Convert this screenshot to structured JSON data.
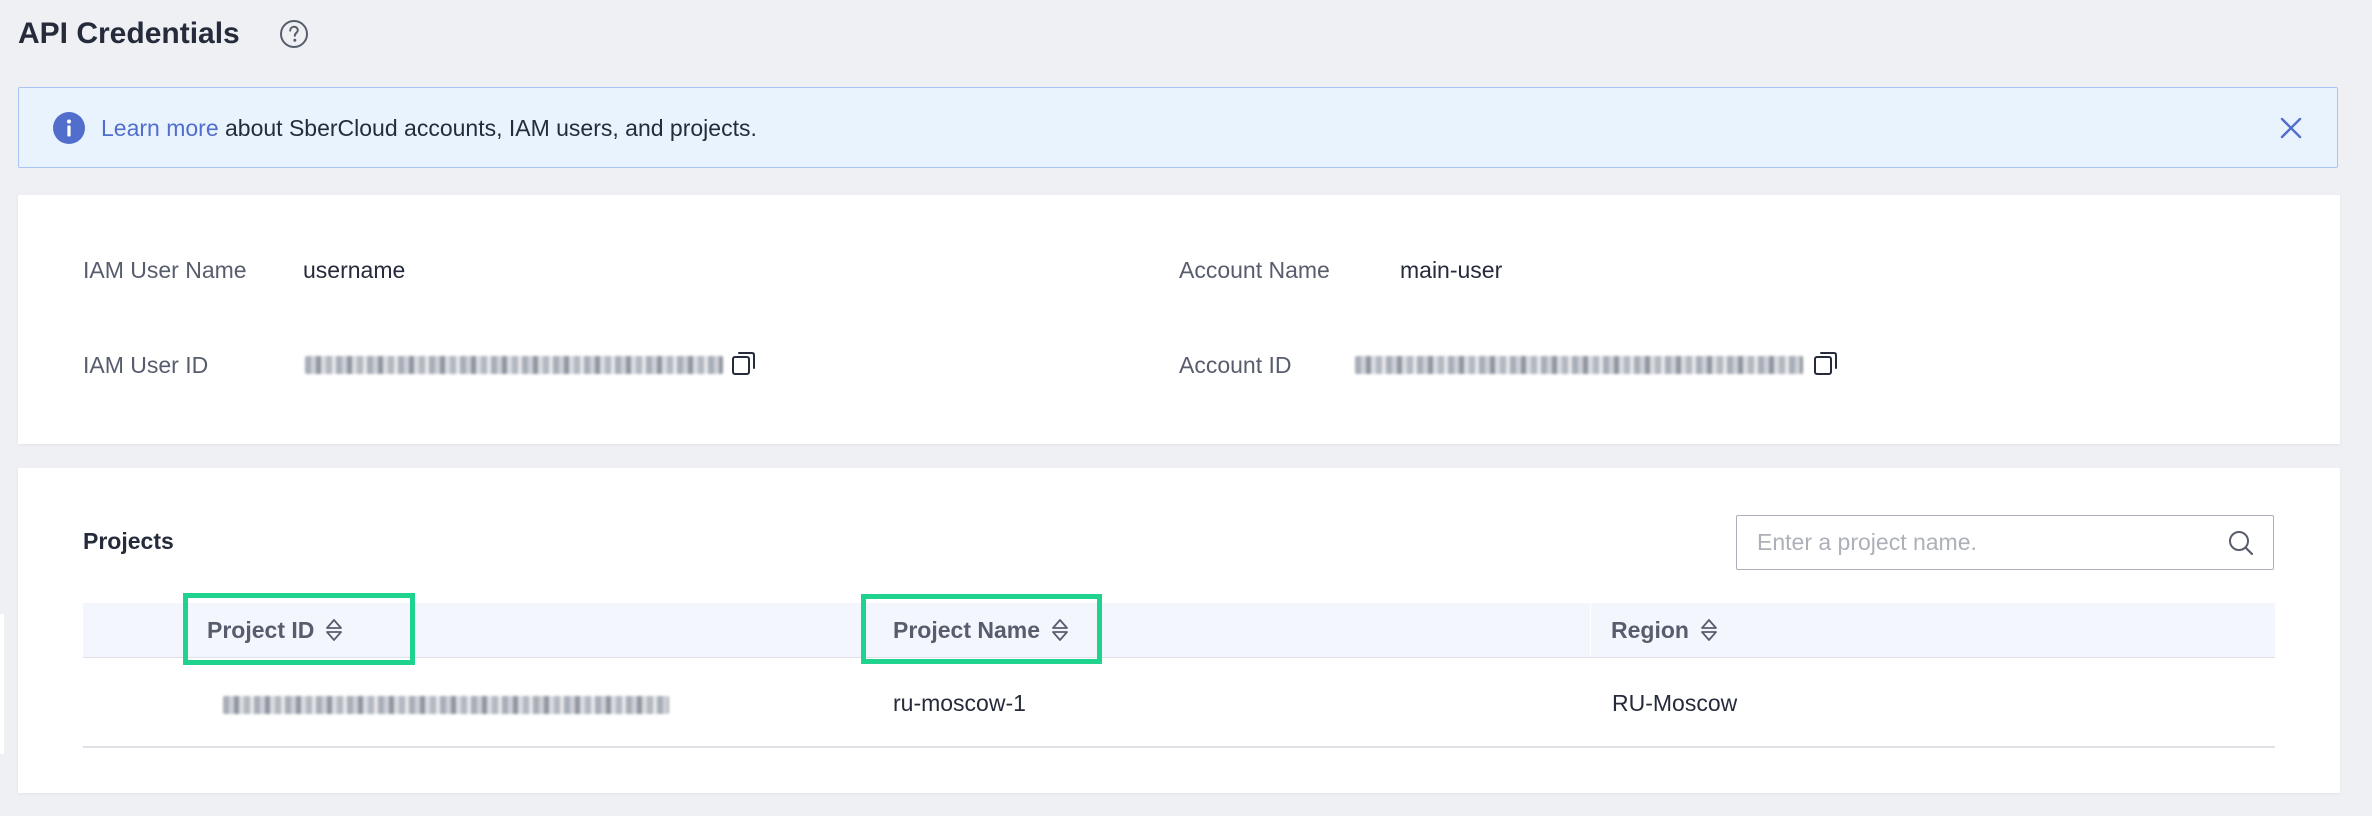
{
  "header": {
    "title": "API Credentials",
    "help_icon": "question-circle-icon"
  },
  "banner": {
    "icon": "info-circle-icon",
    "link_text": "Learn more",
    "text": " about SberCloud accounts, IAM users, and projects.",
    "close_icon": "close-icon",
    "accent_color": "#526ecc"
  },
  "user_info": {
    "iam_user_name_label": "IAM User Name",
    "iam_user_name_value": "username",
    "iam_user_id_label": "IAM User ID",
    "account_name_label": "Account Name",
    "account_name_value": "main-user",
    "account_id_label": "Account ID",
    "copy_icon": "copy-icon"
  },
  "projects": {
    "title": "Projects",
    "search": {
      "placeholder": "Enter a project name.",
      "value": ""
    },
    "columns": [
      {
        "label": "Project ID",
        "sort_icon": "sort-icon",
        "highlighted": true
      },
      {
        "label": "Project Name",
        "sort_icon": "sort-icon",
        "highlighted": true
      },
      {
        "label": "Region",
        "sort_icon": "sort-icon",
        "highlighted": false
      }
    ],
    "rows": [
      {
        "project_name": "ru-moscow-1",
        "region": "RU-Moscow"
      }
    ],
    "highlight_color": "#1fd38f"
  }
}
